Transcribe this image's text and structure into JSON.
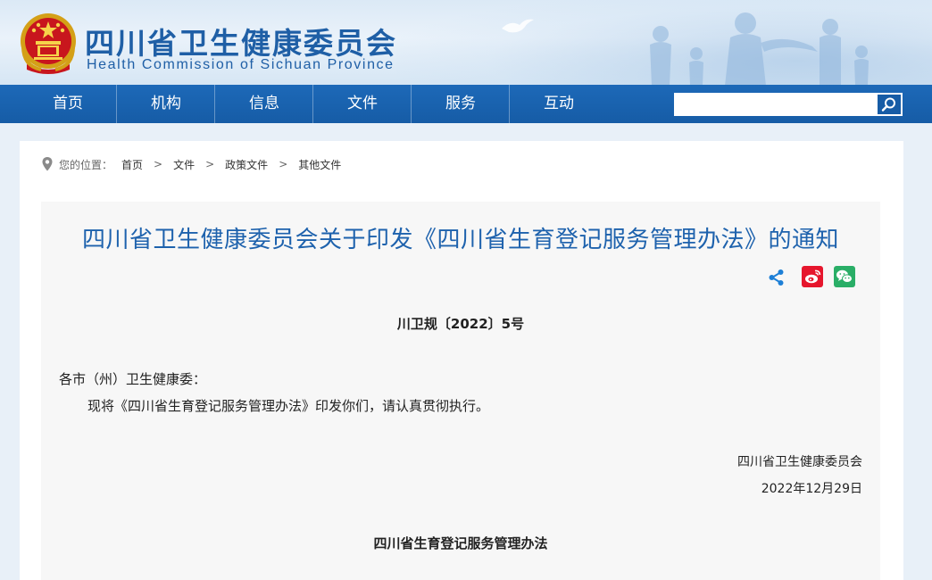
{
  "header": {
    "site_title": "四川省卫生健康委员会",
    "site_subtitle": "Health Commission of Sichuan Province"
  },
  "nav": {
    "items": [
      {
        "label": "首页"
      },
      {
        "label": "机构"
      },
      {
        "label": "信息"
      },
      {
        "label": "文件"
      },
      {
        "label": "服务"
      },
      {
        "label": "互动"
      }
    ]
  },
  "search": {
    "value": "",
    "placeholder": "",
    "icon": "search-icon"
  },
  "breadcrumb": {
    "label": "您的位置：",
    "items": [
      "首页",
      "文件",
      "政策文件",
      "其他文件"
    ],
    "separator": ">"
  },
  "article": {
    "title": "四川省卫生健康委员会关于印发《四川省生育登记服务管理办法》的通知",
    "share_icons": [
      "share-icon",
      "weibo-icon",
      "wechat-icon"
    ],
    "doc_number": "川卫规〔2022〕5号",
    "salutation": "各市（州）卫生健康委：",
    "body": "现将《四川省生育登记服务管理办法》印发你们，请认真贯彻执行。",
    "issuer": "四川省卫生健康委员会",
    "date": "2022年12月29日",
    "section_title": "四川省生育登记服务管理办法"
  },
  "colors": {
    "brand_blue": "#1f5fa6",
    "nav_blue": "#165ca6",
    "title_blue": "#1e62ad",
    "weibo_red": "#e6162d",
    "wechat_green": "#2aae67",
    "share_blue": "#1d7fd6"
  }
}
